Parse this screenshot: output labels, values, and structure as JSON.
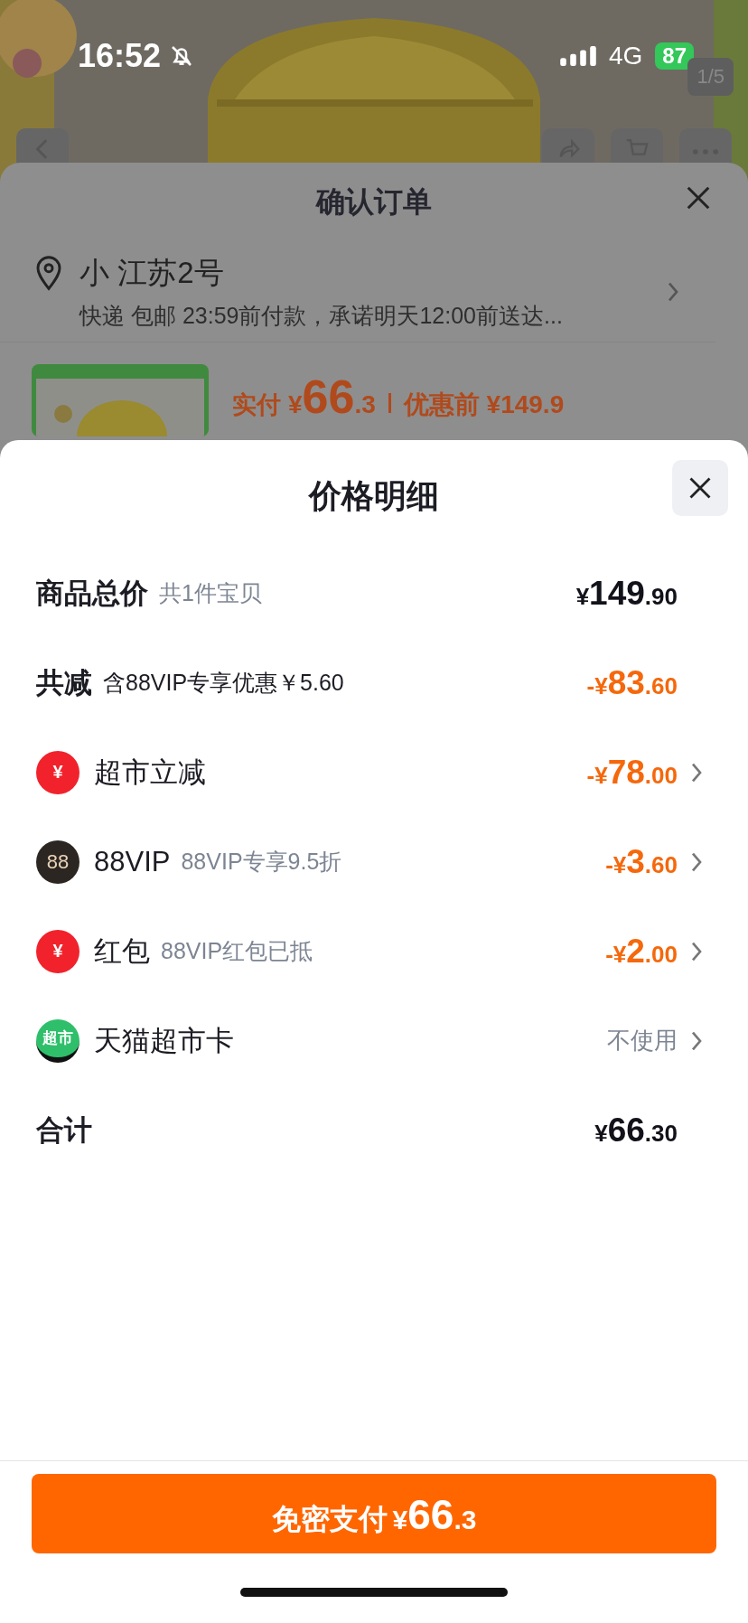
{
  "status_bar": {
    "time": "16:52",
    "network": "4G",
    "battery": "87"
  },
  "photo": {
    "counter": "1/5"
  },
  "order_sheet": {
    "title": "确认订单",
    "address": {
      "name": "小 江苏2号",
      "delivery": "快递 包邮 23:59前付款，承诺明天12:00前送达..."
    },
    "product": {
      "paid_label": "实付",
      "paid_amount": "¥66.3",
      "before_label": "优惠前",
      "before_amount": "¥149.9"
    }
  },
  "price_sheet": {
    "title": "价格明细",
    "rows": [
      {
        "kind": "subtotal",
        "label": "商品总价",
        "note": "共1件宝贝",
        "amount": "¥149.90"
      },
      {
        "kind": "reduction",
        "label": "共减",
        "note": "含88VIP专享优惠￥5.60",
        "amount": "-¥83.60"
      },
      {
        "kind": "discount",
        "icon_text": "¥",
        "label": "超市立减",
        "amount": "-¥78.00"
      },
      {
        "kind": "discount",
        "icon_text": "88",
        "label": "88VIP",
        "note": "88VIP专享9.5折",
        "amount": "-¥3.60"
      },
      {
        "kind": "discount",
        "icon_text": "¥",
        "label": "红包",
        "note": "88VIP红包已抵",
        "amount": "-¥2.00"
      },
      {
        "kind": "option",
        "icon_text": "超市",
        "label": "天猫超市卡",
        "value": "不使用"
      },
      {
        "kind": "total",
        "label": "合计",
        "amount": "¥66.30"
      }
    ]
  },
  "pay_button": {
    "label": "免密支付",
    "amount": "¥66.3"
  }
}
